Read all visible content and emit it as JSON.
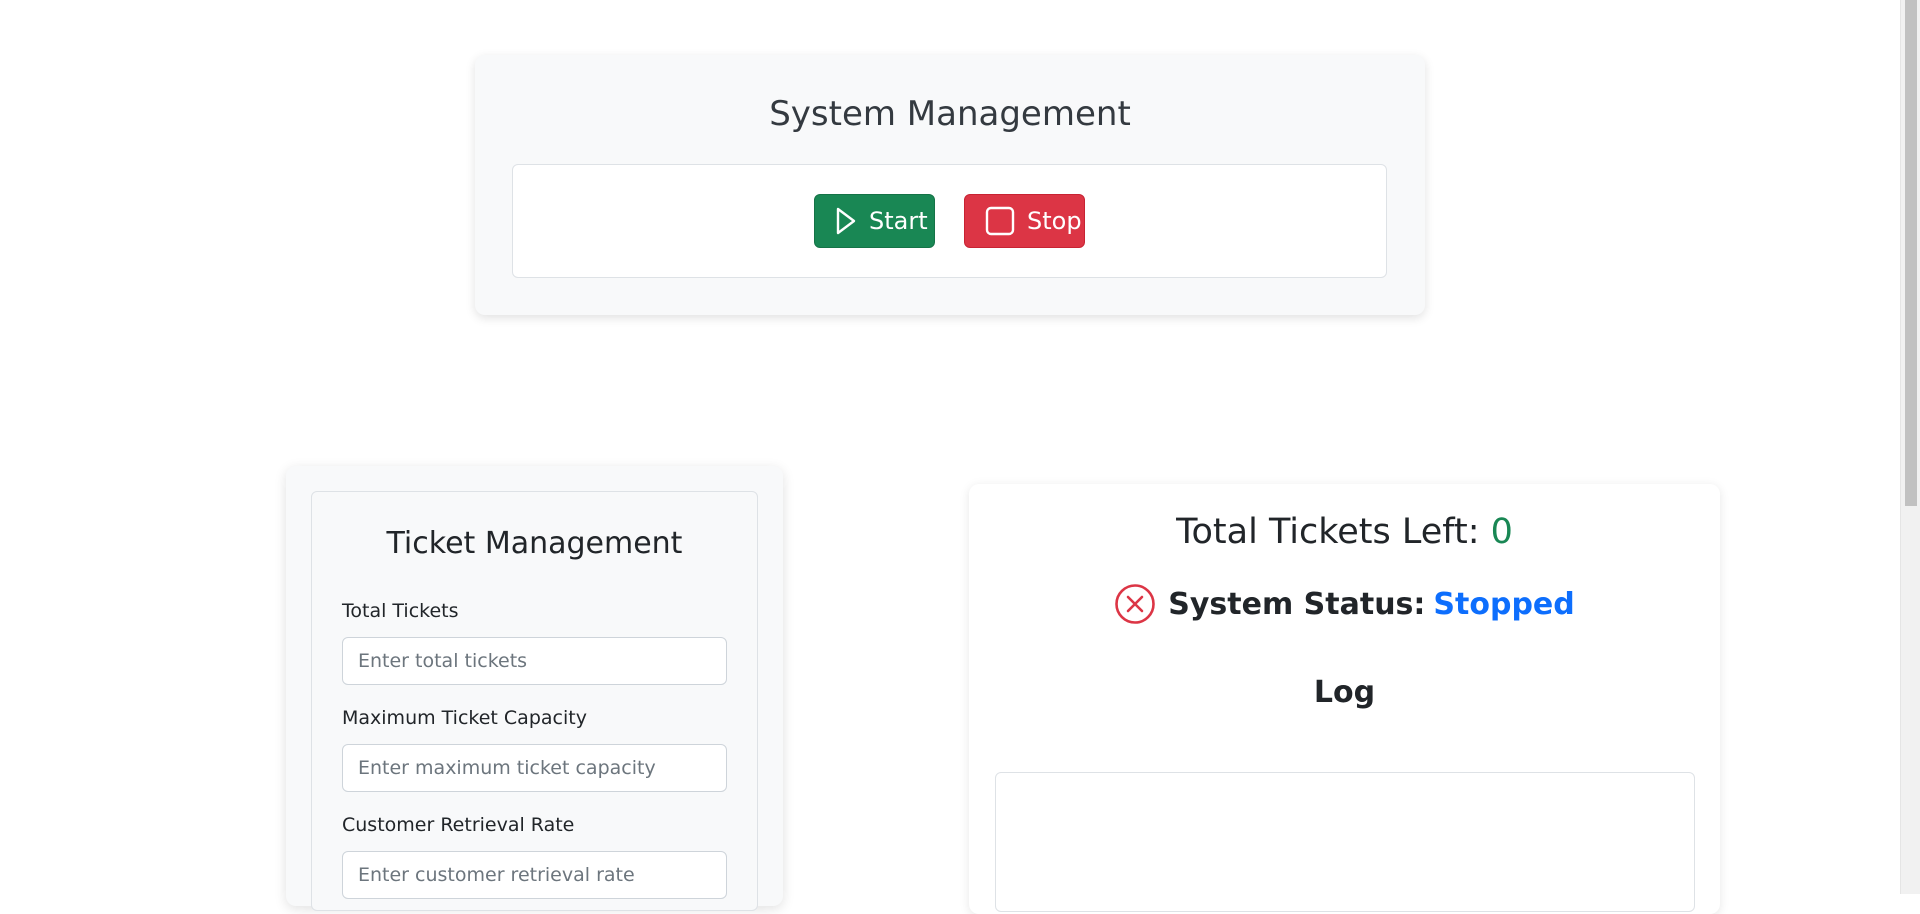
{
  "system_management": {
    "title": "System Management",
    "start_label": "Start",
    "stop_label": "Stop"
  },
  "ticket_management": {
    "title": "Ticket Management",
    "fields": [
      {
        "label": "Total Tickets",
        "placeholder": "Enter total tickets",
        "value": ""
      },
      {
        "label": "Maximum Ticket Capacity",
        "placeholder": "Enter maximum ticket capacity",
        "value": ""
      },
      {
        "label": "Customer Retrieval Rate",
        "placeholder": "Enter customer retrieval rate",
        "value": ""
      }
    ]
  },
  "status_panel": {
    "tickets_left_label": "Total Tickets Left:",
    "tickets_left_value": "0",
    "system_status_label": "System Status:",
    "system_status_value": "Stopped",
    "log_title": "Log",
    "log_entries": []
  },
  "colors": {
    "start": "#198754",
    "stop": "#dc3545",
    "status_value": "#0d6efd",
    "tickets_value": "#198754",
    "status_icon": "#dc3545"
  },
  "icons": {
    "start": "play-icon",
    "stop": "stop-square-icon",
    "status": "x-circle-icon"
  }
}
